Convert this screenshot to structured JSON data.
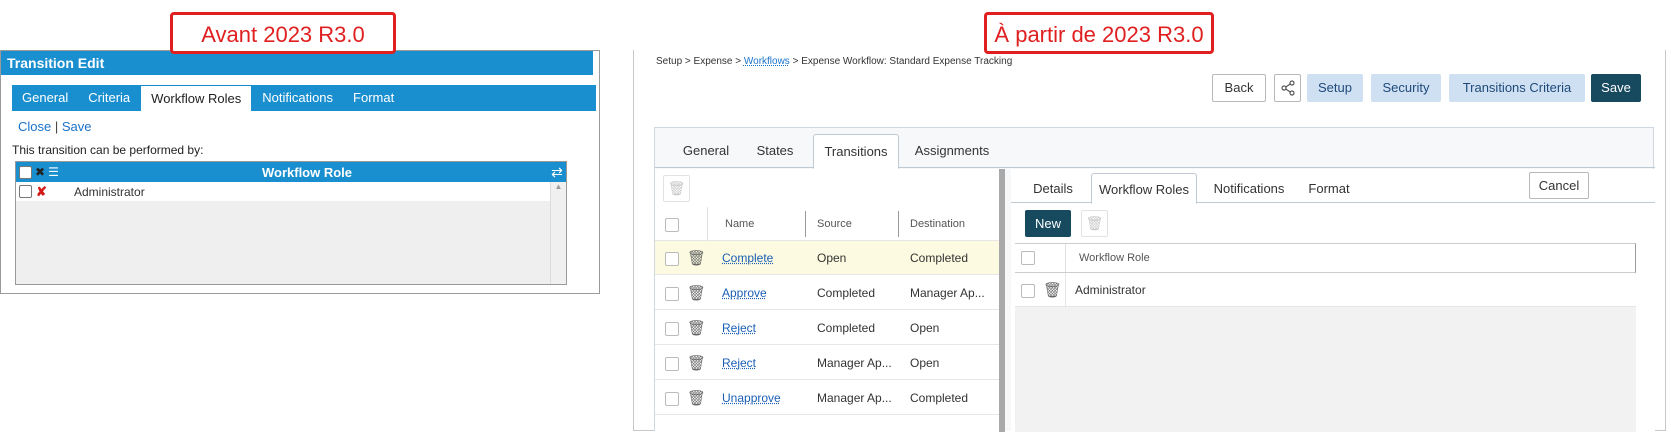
{
  "callouts": {
    "before": "Avant 2023 R3.0",
    "after": "À partir de 2023 R3.0"
  },
  "old_ui": {
    "title": "Transition Edit",
    "tabs": [
      "General",
      "Criteria",
      "Workflow Roles",
      "Notifications",
      "Format"
    ],
    "active_tab": "Workflow Roles",
    "links": {
      "close": "Close",
      "separator": "|",
      "save": "Save"
    },
    "description": "This transition can be performed by:",
    "grid": {
      "header": "Workflow Role",
      "rows": [
        "Administrator"
      ]
    }
  },
  "new_ui": {
    "breadcrumb": {
      "setup": "Setup",
      "sep": ">",
      "expense": "Expense",
      "workflows": "Workflows",
      "current": "Expense Workflow: Standard Expense Tracking"
    },
    "toolbar": {
      "back": "Back",
      "setup": "Setup",
      "security": "Security",
      "transitions_criteria": "Transitions Criteria",
      "save": "Save"
    },
    "tabs": [
      "General",
      "States",
      "Transitions",
      "Assignments"
    ],
    "active_tab": "Transitions",
    "transitions_grid": {
      "columns": [
        "Name",
        "Source",
        "Destination"
      ],
      "rows": [
        {
          "name": "Complete",
          "source": "Open",
          "destination": "Completed"
        },
        {
          "name": "Approve",
          "source": "Completed",
          "destination": "Manager Ap..."
        },
        {
          "name": "Reject",
          "source": "Completed",
          "destination": "Open"
        },
        {
          "name": "Reject",
          "source": "Manager Ap...",
          "destination": "Open"
        },
        {
          "name": "Unapprove",
          "source": "Manager Ap...",
          "destination": "Completed"
        }
      ]
    },
    "detail_tabs": [
      "Details",
      "Workflow Roles",
      "Notifications",
      "Format"
    ],
    "detail_active_tab": "Workflow Roles",
    "cancel": "Cancel",
    "new": "New",
    "roles_grid": {
      "header": "Workflow Role",
      "rows": [
        "Administrator"
      ]
    }
  },
  "colors": {
    "old_blue": "#1a8fcf",
    "callout_red": "#e02020",
    "dark_button": "#17495f",
    "light_button": "#cfe0f3",
    "highlight_row": "#fcfbe1"
  }
}
